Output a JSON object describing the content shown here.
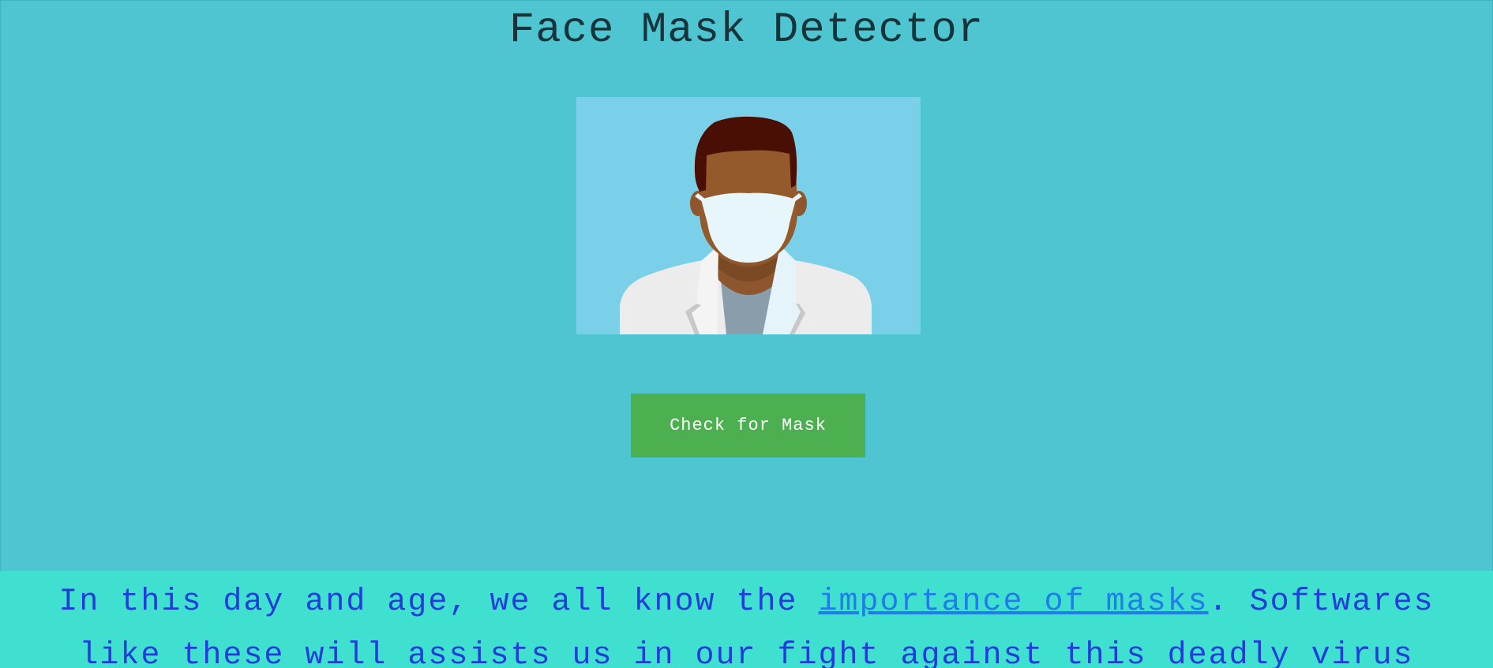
{
  "page": {
    "title": "Face Mask Detector"
  },
  "illustration": {
    "icon": "doctor-with-face-mask-illustration",
    "background_color": "#79d0e8"
  },
  "actions": {
    "check_button_label": "Check for Mask",
    "check_button_color": "#4caf50"
  },
  "info": {
    "text_before_link": "In this day and age, we all know the ",
    "link_text": "importance of masks",
    "text_after_link": ". Softwares like these will assists us in our fight against this deadly virus",
    "banner_color": "#40e0d0",
    "text_color": "#1f3fd8"
  },
  "colors": {
    "page_background": "#4ec5d1",
    "title_color": "#16343a"
  }
}
